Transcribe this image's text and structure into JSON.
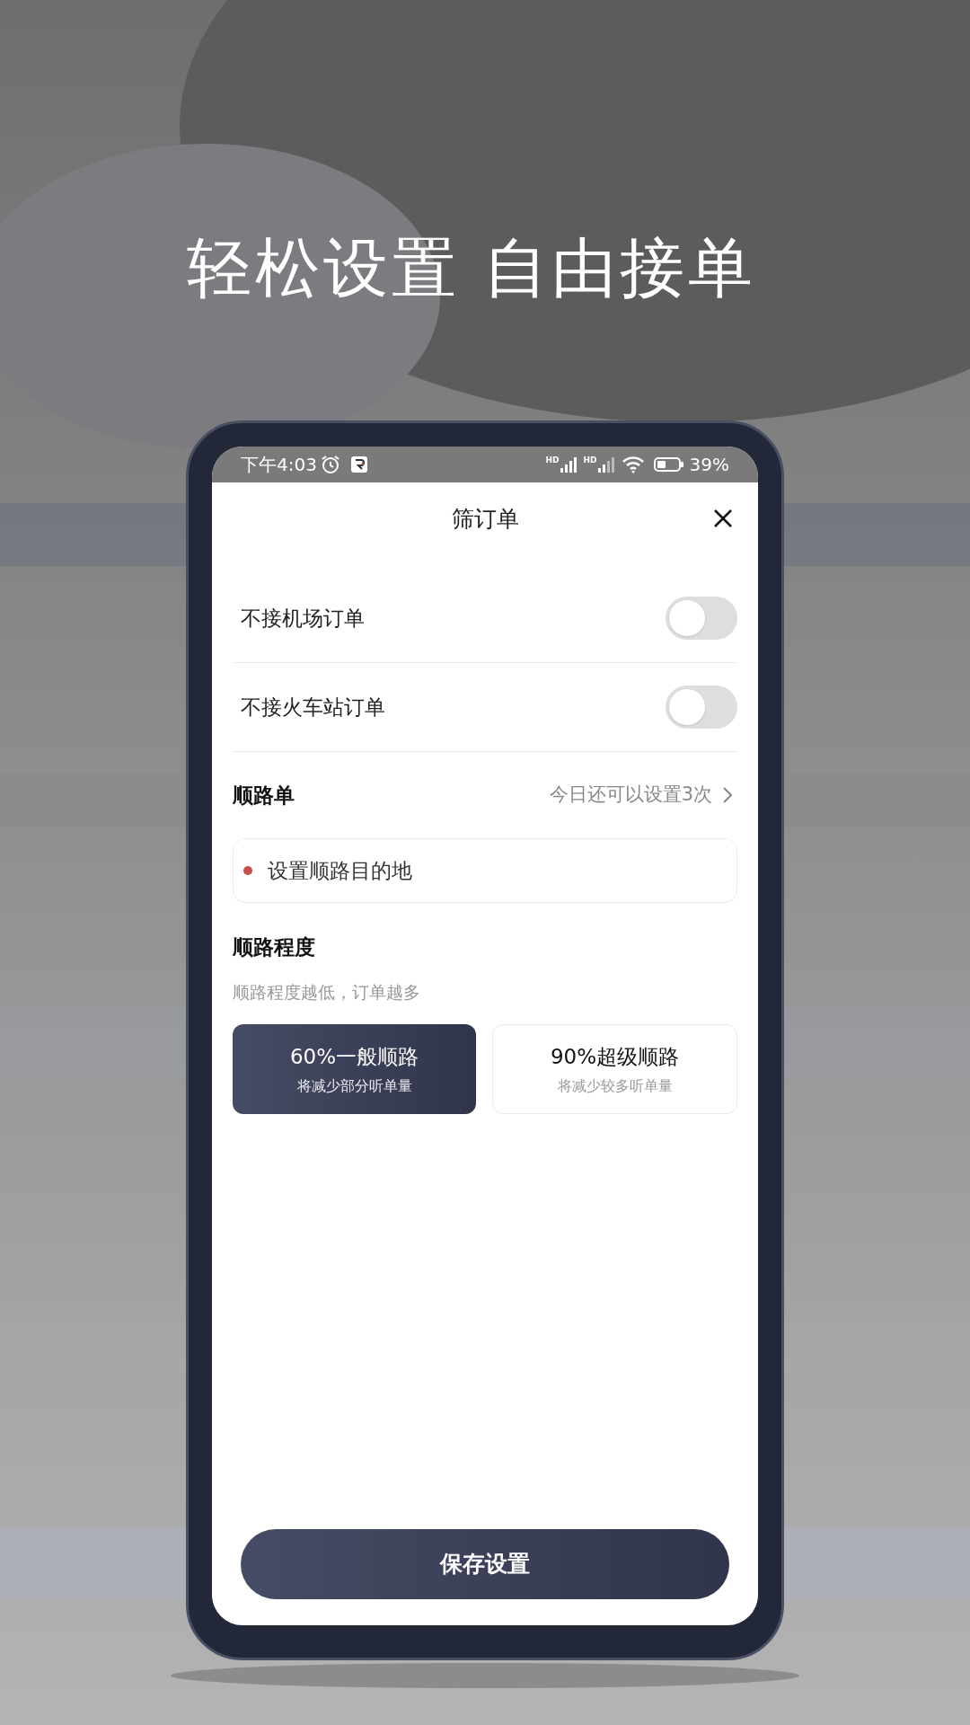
{
  "headline": "轻松设置 自由接单",
  "status_bar": {
    "time": "下午4:03",
    "signal_labels": [
      "HD",
      "HD"
    ],
    "battery": "39%"
  },
  "sheet_title": "筛订单",
  "toggles": [
    {
      "label": "不接机场订单",
      "on": false
    },
    {
      "label": "不接火车站订单",
      "on": false
    }
  ],
  "route": {
    "title": "顺路单",
    "remaining": "今日还可以设置3次",
    "placeholder": "设置顺路目的地"
  },
  "degree": {
    "title": "顺路程度",
    "hint": "顺路程度越低，订单越多",
    "options": [
      {
        "title": "60%一般顺路",
        "subtitle": "将减少部分听单量",
        "selected": true
      },
      {
        "title": "90%超级顺路",
        "subtitle": "将减少较多听单量",
        "selected": false
      }
    ]
  },
  "save_button": "保存设置"
}
